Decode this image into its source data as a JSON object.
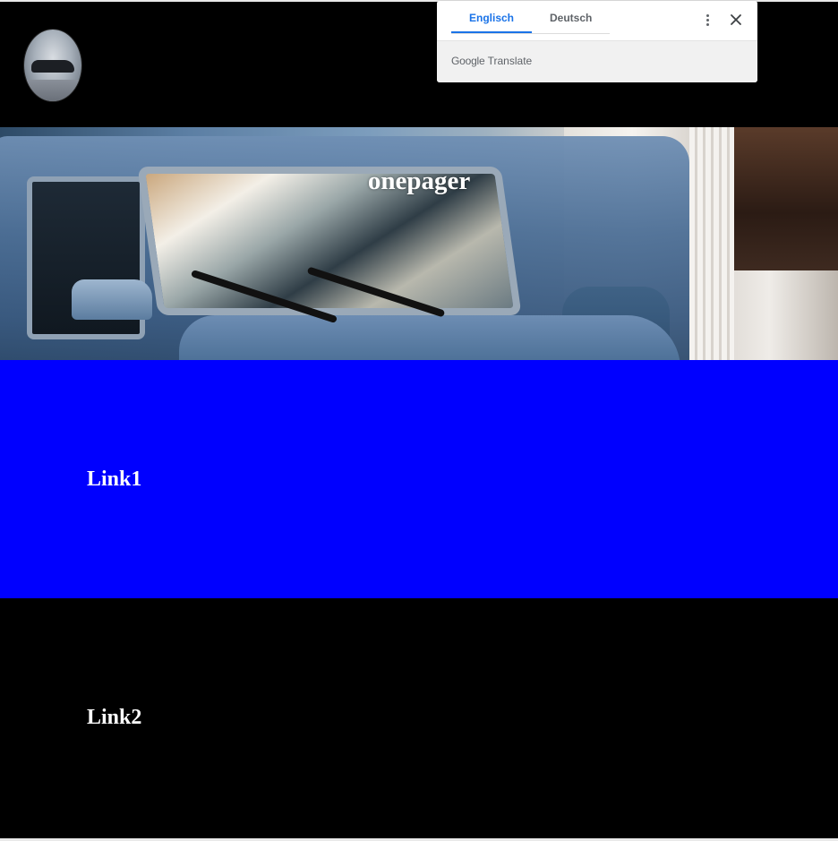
{
  "hero": {
    "title": "onepager"
  },
  "sections": [
    {
      "heading": "Link1",
      "color": "#0000ff"
    },
    {
      "heading": "Link2",
      "color": "#000000"
    }
  ],
  "translate": {
    "tabs": [
      {
        "label": "Englisch",
        "active": true
      },
      {
        "label": "Deutsch",
        "active": false
      }
    ],
    "brand_google": "Google",
    "brand_product": "Translate",
    "menu_icon": "more-vert-icon",
    "close_icon": "close-icon",
    "accent": "#1a73e8"
  },
  "logo": {
    "icon": "car-photo-avatar"
  }
}
